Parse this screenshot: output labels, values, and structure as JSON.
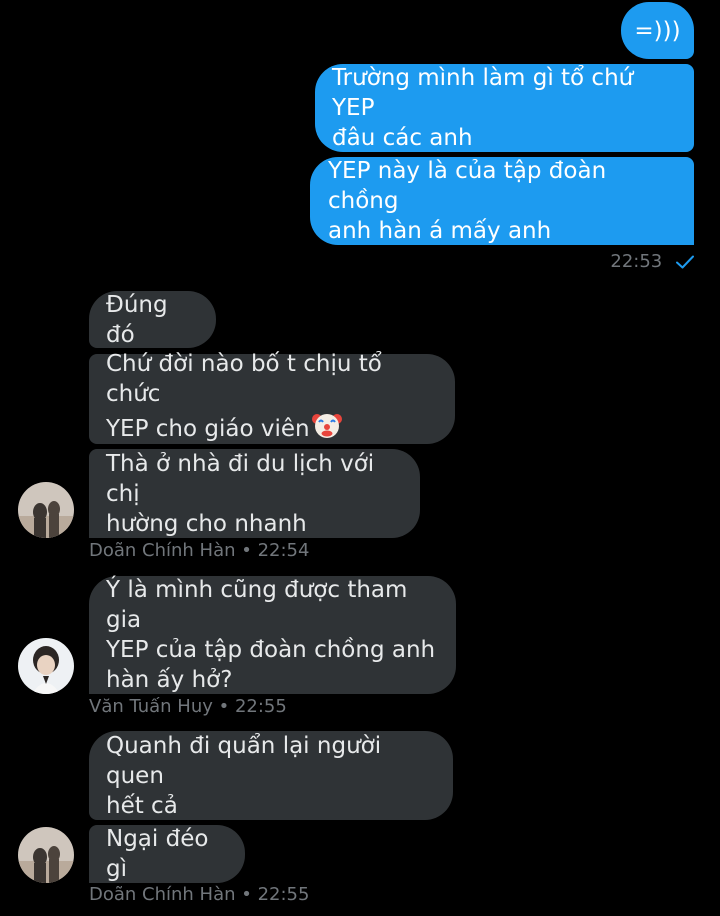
{
  "colors": {
    "background": "#000000",
    "outgoing_bubble": "#1d9bf0",
    "incoming_bubble": "#2f3336",
    "meta_text": "#71767b",
    "read_check": "#1d9bf0"
  },
  "outgoing": {
    "messages": [
      {
        "text": "=)))"
      },
      {
        "text": "Trường mình làm gì tổ chứ YEP\nđâu các anh"
      },
      {
        "text": "YEP này là của tập đoàn chồng\nanh hàn á mấy anh"
      }
    ],
    "time": "22:53",
    "status_icon": "read-check-icon"
  },
  "groups": [
    {
      "sender": "Doãn Chính Hàn",
      "time": "22:54",
      "meta": "Doãn Chính Hàn • 22:54",
      "avatar": "avatar-icon",
      "messages": [
        {
          "text": "Đúng đó"
        },
        {
          "text": "Chứ đời nào bố t chịu tổ chức\nYEP cho giáo viên",
          "emoji": "clown-face-icon"
        },
        {
          "text": "Thà ở nhà đi du lịch với chị\nhường cho nhanh"
        }
      ]
    },
    {
      "sender": "Văn Tuấn Huy",
      "time": "22:55",
      "meta": "Văn Tuấn Huy • 22:55",
      "avatar": "avatar-icon",
      "messages": [
        {
          "text": "Ý là mình cũng được tham gia\nYEP của tập đoàn chồng anh\nhàn ấy hở?"
        }
      ]
    },
    {
      "sender": "Doãn Chính Hàn",
      "time": "22:55",
      "meta": "Doãn Chính Hàn • 22:55",
      "avatar": "avatar-icon",
      "messages": [
        {
          "text": "Quanh đi quẩn lại người quen\nhết cả"
        },
        {
          "text": "Ngại đéo gì"
        }
      ]
    }
  ]
}
